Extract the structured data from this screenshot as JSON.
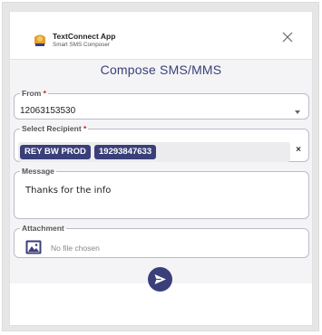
{
  "app": {
    "title": "TextConnect App",
    "subtitle": "Smart SMS Composer"
  },
  "compose": {
    "title": "Compose SMS/MMS"
  },
  "from": {
    "label": "From",
    "required": "*",
    "value": "12063153530"
  },
  "recipient": {
    "label": "Select Recipient",
    "required": "*",
    "chips": [
      "REY BW PROD",
      "19293847633"
    ],
    "clear": "×"
  },
  "message": {
    "label": "Message",
    "value": "Thanks for the info"
  },
  "attachment": {
    "label": "Attachment",
    "status": "No file chosen"
  },
  "icons": {
    "logo": "app-logo-icon",
    "close": "close-icon",
    "dropdown": "chevron-down-icon",
    "image": "image-icon",
    "send": "send-icon"
  },
  "colors": {
    "accent": "#3a3f7a",
    "required": "#d32020"
  }
}
